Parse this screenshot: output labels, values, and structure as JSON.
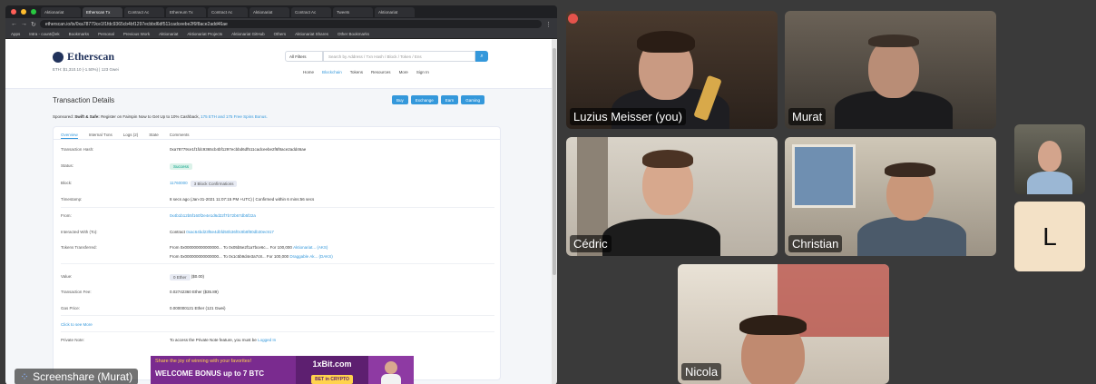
{
  "browser": {
    "tabs": [
      "Aktionariat",
      "Etherscan Tx",
      "Contract Ac",
      "Ethereum Tx",
      "Contract Ac",
      "Aktionariat",
      "Contract Ac",
      "Tweets",
      "Aktionariat"
    ],
    "url": "etherscan.io/tx/0xa78779ce1f1fdc9365cb4bf1297ecbbd6df511cadceebe2f6f8ace2add46ae",
    "bookmarks": [
      "Apps",
      "Intra - count@ek",
      "Bookmarks",
      "Personal",
      "Previous Work",
      "Aktionariat",
      "Aktionariat Projects",
      "Aktionariat GitHub",
      "Others",
      "Aktionariat Shares",
      "Other Bookmarks"
    ]
  },
  "etherscan": {
    "logo": "Etherscan",
    "price": "ETH: $1,310.10 (-1.50%) | 123 Gwei",
    "filter": "All Filters",
    "search_placeholder": "Search by Address / Txn Hash / Block / Token / Ens",
    "nav": [
      "Home",
      "Blockchain",
      "Tokens",
      "Resources",
      "More",
      "Sign In"
    ],
    "title": "Transaction Details",
    "actions": [
      "Buy",
      "Exchange",
      "Earn",
      "Gaming"
    ],
    "sponsor_label": "Sponsored:",
    "sponsor_name": "Swift & Safe:",
    "sponsor_text": "Register on Fairspin Now to Get Up to 10% Cashback,",
    "sponsor_link": "175 ETH and 175 Free Spins Bonus.",
    "tabs": [
      "Overview",
      "Internal Txns",
      "Logs (2)",
      "State",
      "Comments"
    ],
    "rows": {
      "hash_label": "Transaction Hash:",
      "hash_value": "0xa78779ce1f1fdc9365cb4bf1297ecbbd6df511cadceebe2f6f8ace2add46ae",
      "status_label": "Status:",
      "status_value": "Success",
      "block_label": "Block:",
      "block_value": "11760000",
      "block_conf": "3 Block Confirmations",
      "time_label": "Timestamp:",
      "time_value": "8 secs ago (Jan-31-2021 11:07:15 PM +UTC) | Confirmed within 6 mins:56 secs",
      "from_label": "From:",
      "from_value": "0x4b1b12b5f160f2e4e1d6d22f7b72b67db5f22a",
      "to_label": "Interacted With (To):",
      "to_prefix": "Contract",
      "to_value": "0xac64bd23f6e4dbfd50b36f0c9b8f80db30ec917",
      "tokens_label": "Tokens Transferred:",
      "token1_from": "From 0x000000000000000...",
      "token1_to": "To 0x05b5e2f1a7bce6c...",
      "token1_for": "For 100,000",
      "token1_name": "Aktionariat... (AKS)",
      "token2_from": "From 0x000000000000000...",
      "token2_to": "To 0x1c5b9d4e3a7c8...",
      "token2_for": "For 100,000",
      "token2_name": "Draggable Ak... (DAKS)",
      "value_label": "Value:",
      "value_value": "0 Ether",
      "value_usd": "($0.00)",
      "fee_label": "Transaction Fee:",
      "fee_value": "0.02742360 Ether ($35.89)",
      "gas_label": "Gas Price:",
      "gas_value": "0.000000121 Ether (121 Gwei)",
      "more": "Click to see More",
      "note_label": "Private Note:",
      "note_value": "To access the Private Note feature, you must be",
      "note_link": "Logged In"
    }
  },
  "share_label": "Screenshare (Murat)",
  "ad": {
    "line1": "Share the joy of winning with your favorites!",
    "line2": "WELCOME BONUS up to 7 BTC",
    "brand": "1xBit.com",
    "cta": "BET in CRYPTO"
  },
  "participants": {
    "p1": "Luzius Meisser (you)",
    "p2": "Murat",
    "p3": "Cédric",
    "p4": "Christian",
    "p5": "Nicola",
    "p6_initial": "L"
  }
}
